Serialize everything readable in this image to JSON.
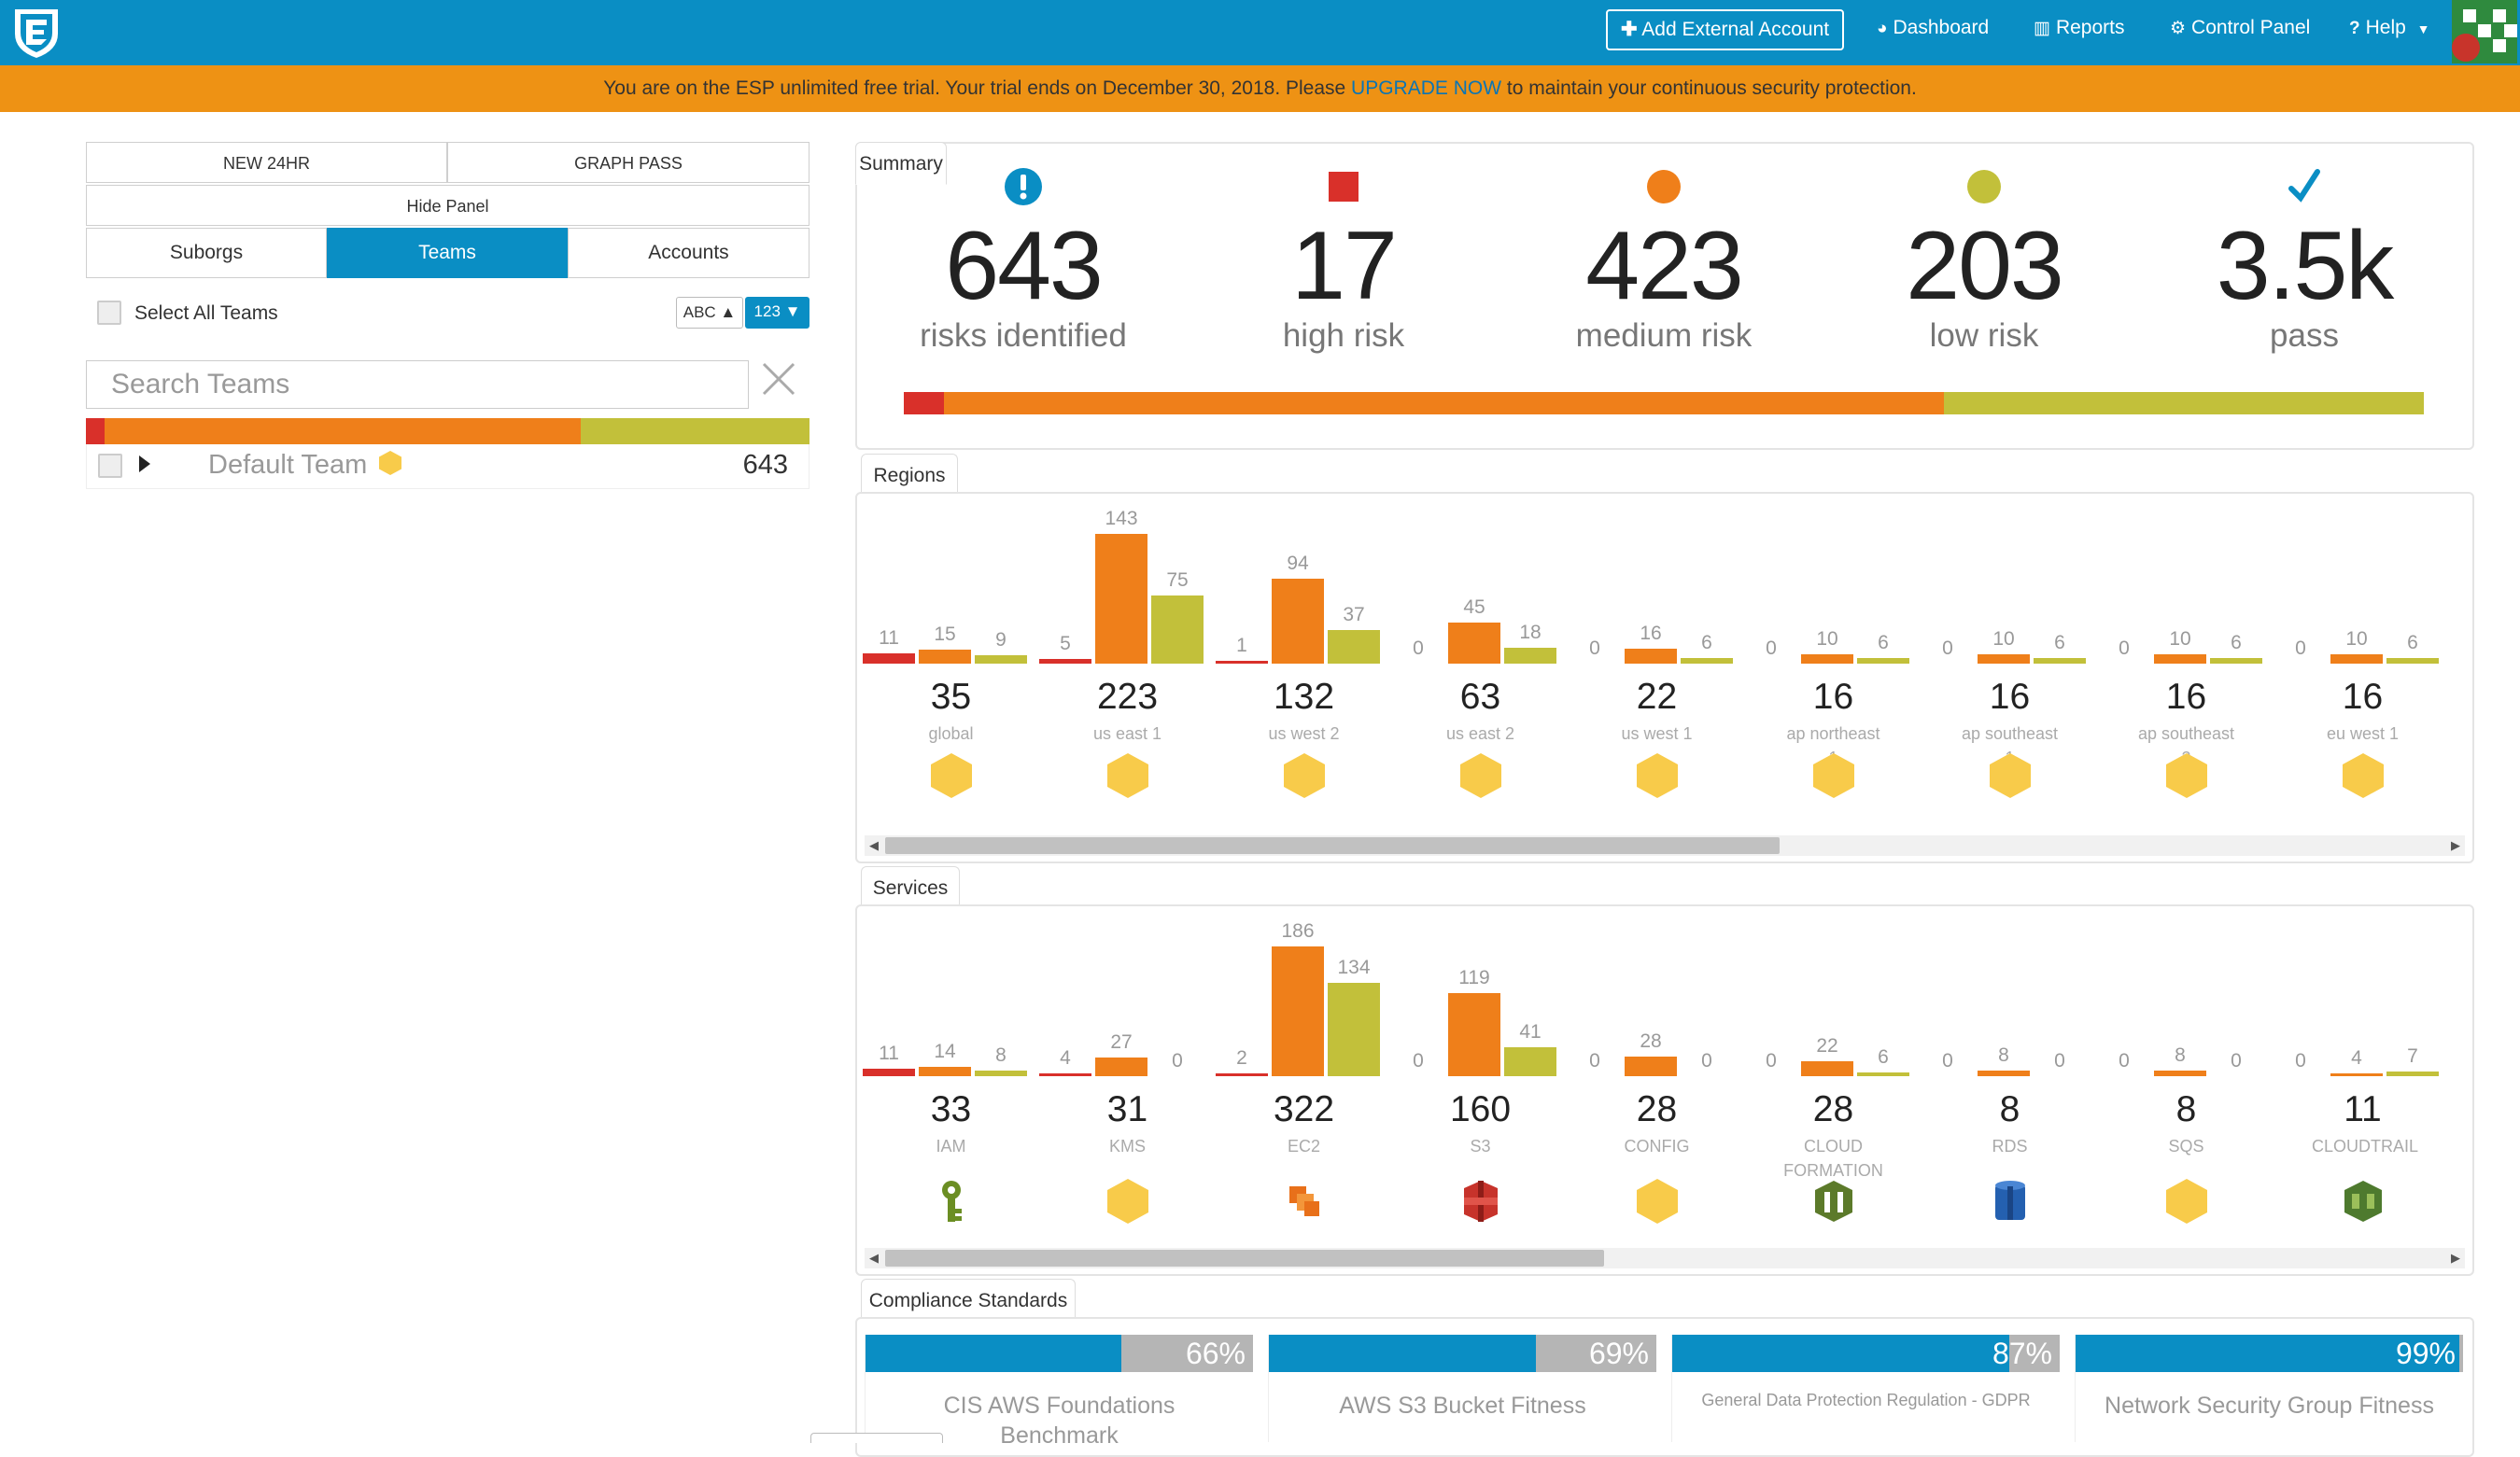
{
  "header": {
    "add_account": "Add External Account",
    "nav": [
      {
        "label": "Dashboard",
        "icon": "dashboard-icon"
      },
      {
        "label": "Reports",
        "icon": "bar-chart-icon"
      },
      {
        "label": "Control Panel",
        "icon": "cogs-icon"
      },
      {
        "label": "Help",
        "icon": "question-icon"
      }
    ]
  },
  "banner": {
    "text_before": "You are on the ESP unlimited free trial. Your trial ends on December 30, 2018. Please",
    "link": "UPGRADE NOW",
    "text_after": "to maintain your continuous security protection."
  },
  "left_panel": {
    "new_24hr": "NEW 24HR",
    "graph_pass": "GRAPH PASS",
    "hide_panel": "Hide Panel",
    "tabs": [
      "Suborgs",
      "Teams",
      "Accounts"
    ],
    "active_tab": "Teams",
    "select_all": "Select All Teams",
    "sort_abc": "ABC ▲",
    "sort_123": "123 ▼",
    "search_placeholder": "Search Teams",
    "teams": [
      {
        "name": "Default Team",
        "count": "643",
        "high": 17,
        "medium": 423,
        "low": 203
      }
    ]
  },
  "summary": {
    "tab": "Summary",
    "items": [
      {
        "value": "643",
        "label": "risks identified",
        "icon": "exclamation-icon",
        "color": "#0a8ec4"
      },
      {
        "value": "17",
        "label": "high risk",
        "icon": "square-icon",
        "color": "#d9302a"
      },
      {
        "value": "423",
        "label": "medium risk",
        "icon": "circle-icon",
        "color": "#ef7f1a"
      },
      {
        "value": "203",
        "label": "low risk",
        "icon": "circle-icon",
        "color": "#c2c03a"
      },
      {
        "value": "3.5k",
        "label": "pass",
        "icon": "check-icon",
        "color": "#0a8ec4"
      }
    ],
    "bar": {
      "high": 17,
      "medium": 423,
      "low": 203
    }
  },
  "colors": {
    "high": "#d9302a",
    "medium": "#ef7f1a",
    "low": "#c2c03a",
    "accent": "#0a8ec4",
    "banner": "#ee9214",
    "hex": "#f8cb4a"
  },
  "regions": {
    "tab": "Regions",
    "columns": [
      {
        "name": "global",
        "total": "35",
        "high": 11,
        "medium": 15,
        "low": 9
      },
      {
        "name": "us east 1",
        "total": "223",
        "high": 5,
        "medium": 143,
        "low": 75
      },
      {
        "name": "us west 2",
        "total": "132",
        "high": 1,
        "medium": 94,
        "low": 37
      },
      {
        "name": "us east 2",
        "total": "63",
        "high": 0,
        "medium": 45,
        "low": 18
      },
      {
        "name": "us west 1",
        "total": "22",
        "high": 0,
        "medium": 16,
        "low": 6
      },
      {
        "name": "ap northeast 1",
        "total": "16",
        "high": 0,
        "medium": 10,
        "low": 6
      },
      {
        "name": "ap southeast 1",
        "total": "16",
        "high": 0,
        "medium": 10,
        "low": 6
      },
      {
        "name": "ap southeast 2",
        "total": "16",
        "high": 0,
        "medium": 10,
        "low": 6
      },
      {
        "name": "eu west 1",
        "total": "16",
        "high": 0,
        "medium": 10,
        "low": 6
      }
    ]
  },
  "services": {
    "tab": "Services",
    "columns": [
      {
        "name": "IAM",
        "total": "33",
        "high": 11,
        "medium": 14,
        "low": 8,
        "icon": "iam-key-icon"
      },
      {
        "name": "KMS",
        "total": "31",
        "high": 4,
        "medium": 27,
        "low": 0,
        "icon": "hexagon-icon"
      },
      {
        "name": "EC2",
        "total": "322",
        "high": 2,
        "medium": 186,
        "low": 134,
        "icon": "ec2-instances-icon"
      },
      {
        "name": "S3",
        "total": "160",
        "high": 0,
        "medium": 119,
        "low": 41,
        "icon": "s3-bucket-icon"
      },
      {
        "name": "CONFIG",
        "total": "28",
        "high": 0,
        "medium": 28,
        "low": 0,
        "icon": "hexagon-icon"
      },
      {
        "name": "CLOUD FORMATION",
        "total": "28",
        "high": 0,
        "medium": 22,
        "low": 6,
        "icon": "cloudformation-icon"
      },
      {
        "name": "RDS",
        "total": "8",
        "high": 0,
        "medium": 8,
        "low": 0,
        "icon": "rds-database-icon"
      },
      {
        "name": "SQS",
        "total": "8",
        "high": 0,
        "medium": 8,
        "low": 0,
        "icon": "hexagon-icon"
      },
      {
        "name": "CLOUDTRAIL",
        "total": "11",
        "high": 0,
        "medium": 4,
        "low": 7,
        "icon": "cloudtrail-icon"
      }
    ]
  },
  "compliance": {
    "tab": "Compliance Standards",
    "items": [
      {
        "name": "CIS AWS Foundations Benchmark",
        "pct": "66%",
        "value": 0.66
      },
      {
        "name": "AWS S3 Bucket Fitness",
        "pct": "69%",
        "value": 0.69
      },
      {
        "name": "General Data Protection Regulation - GDPR",
        "pct": "87%",
        "value": 0.87
      },
      {
        "name": "Network Security Group Fitness",
        "pct": "99%",
        "value": 0.99
      }
    ]
  }
}
